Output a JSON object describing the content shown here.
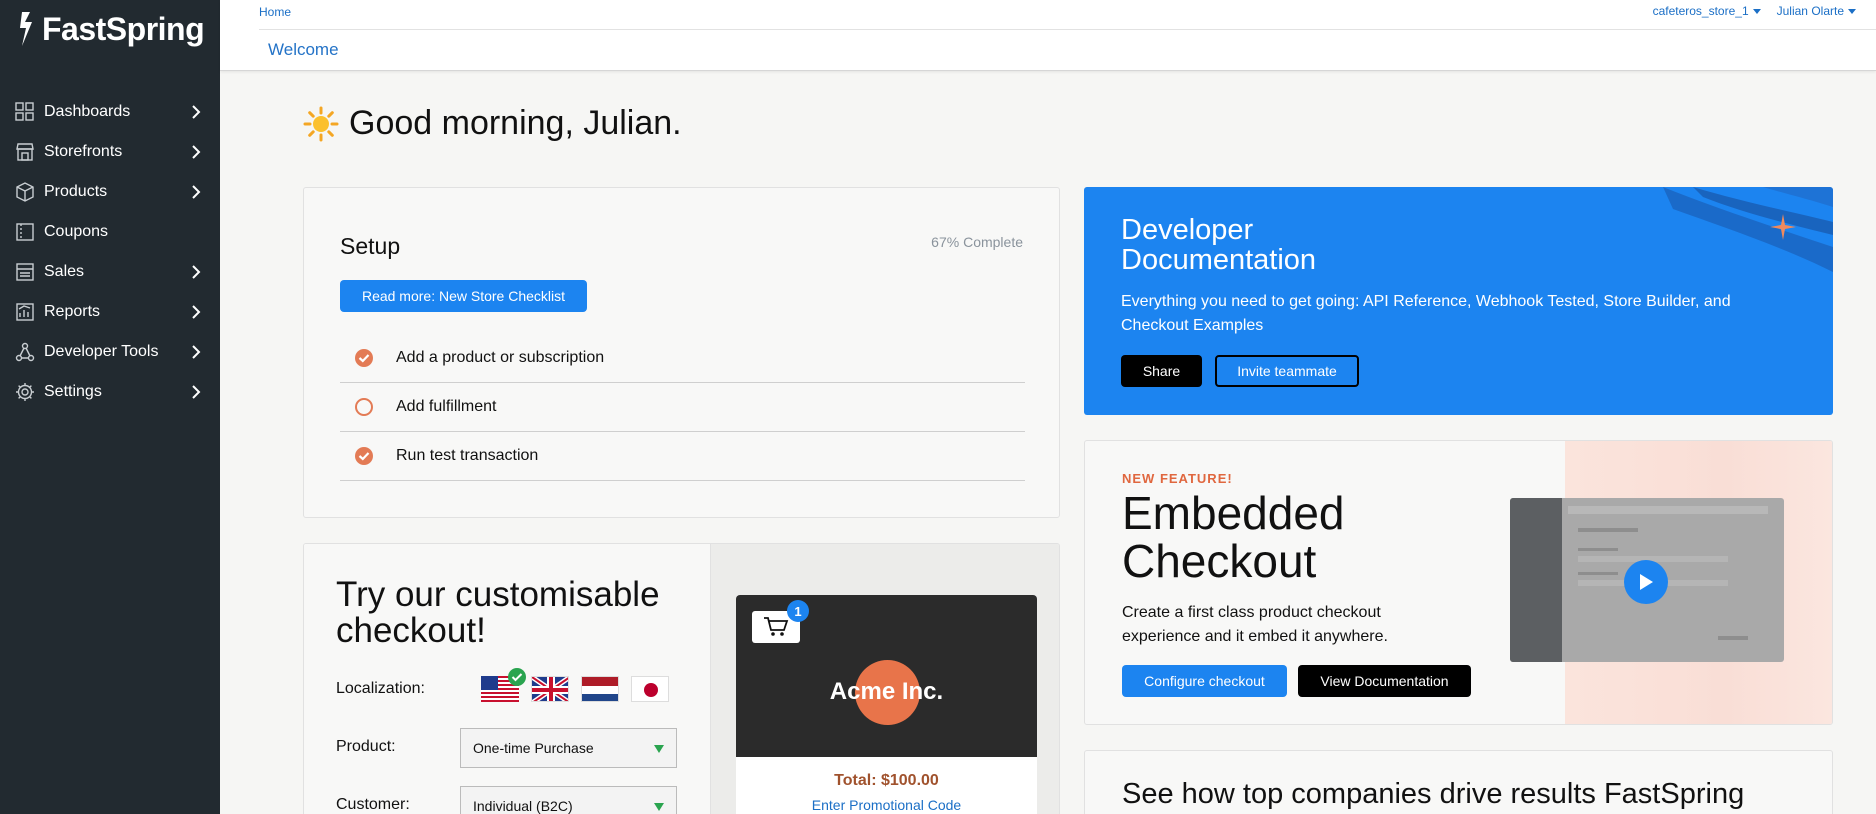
{
  "sidebar": {
    "brand": "FastSpring",
    "items": [
      {
        "label": "Dashboards",
        "icon": "grid-icon",
        "has_children": true
      },
      {
        "label": "Storefronts",
        "icon": "storefront-icon",
        "has_children": true
      },
      {
        "label": "Products",
        "icon": "box-icon",
        "has_children": true
      },
      {
        "label": "Coupons",
        "icon": "coupon-icon",
        "has_children": false
      },
      {
        "label": "Sales",
        "icon": "sales-icon",
        "has_children": true
      },
      {
        "label": "Reports",
        "icon": "chart-icon",
        "has_children": true
      },
      {
        "label": "Developer Tools",
        "icon": "network-icon",
        "has_children": true
      },
      {
        "label": "Settings",
        "icon": "gear-icon",
        "has_children": true
      }
    ]
  },
  "header": {
    "breadcrumb": "Home",
    "title": "Welcome",
    "store_selector": "cafeteros_store_1",
    "user_menu": "Julian Olarte"
  },
  "greeting": "Good morning, Julian.",
  "setup": {
    "title": "Setup",
    "progress": "67% Complete",
    "button": "Read more: New Store Checklist",
    "items": [
      {
        "label": "Add a product or subscription",
        "done": true
      },
      {
        "label": "Add fulfillment",
        "done": false
      },
      {
        "label": "Run test transaction",
        "done": true
      }
    ]
  },
  "demo": {
    "title": "Try our customisable checkout!",
    "localization_label": "Localization:",
    "flags": [
      "US",
      "UK",
      "NL",
      "JP"
    ],
    "selected_flag": "US",
    "product_label": "Product:",
    "product_value": "One-time Purchase",
    "customer_label": "Customer:",
    "customer_value": "Individual (B2C)",
    "cart_count": "1",
    "company": "Acme Inc.",
    "total": "Total: $100.00",
    "promo": "Enter Promotional Code"
  },
  "devdocs": {
    "title": "Developer Documentation",
    "description": "Everything you need to get going: API Reference, Webhook Tested, Store Builder, and Checkout Examples",
    "share": "Share",
    "invite": "Invite teammate"
  },
  "embedded": {
    "tag": "NEW FEATURE!",
    "title": "Embedded Checkout",
    "description": "Create a first class product checkout experience and it embed it anywhere.",
    "configure": "Configure checkout",
    "view_docs": "View Documentation"
  },
  "seehow": {
    "title": "See how top companies drive results FastSpring"
  },
  "colors": {
    "sidebar_bg": "#222a30",
    "accent_blue": "#1c84f0",
    "accent_orange": "#e0673f"
  }
}
